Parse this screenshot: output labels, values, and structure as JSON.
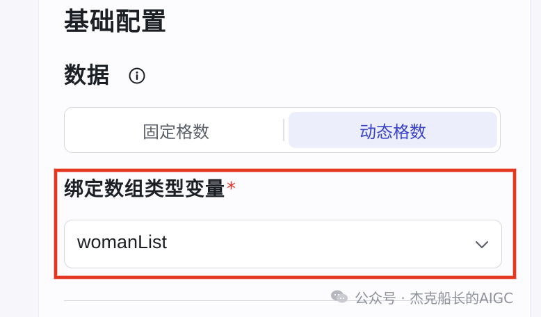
{
  "section": {
    "title": "基础配置"
  },
  "data_section": {
    "label": "数据",
    "info_icon": "info-icon"
  },
  "segmented": {
    "options": [
      {
        "label": "固定格数",
        "selected": false
      },
      {
        "label": "动态格数",
        "selected": true
      }
    ]
  },
  "field": {
    "label": "绑定数组类型变量",
    "required_mark": "*",
    "value": "womanList",
    "dropdown_icon": "chevron-down-icon"
  },
  "watermark": {
    "text": "公众号 · 杰克船长的AIGC",
    "icon": "wechat-icon"
  },
  "colors": {
    "accent": "#3a42c8",
    "selected_bg": "#eceefc",
    "highlight": "#e3381f",
    "required": "#e0362c"
  }
}
